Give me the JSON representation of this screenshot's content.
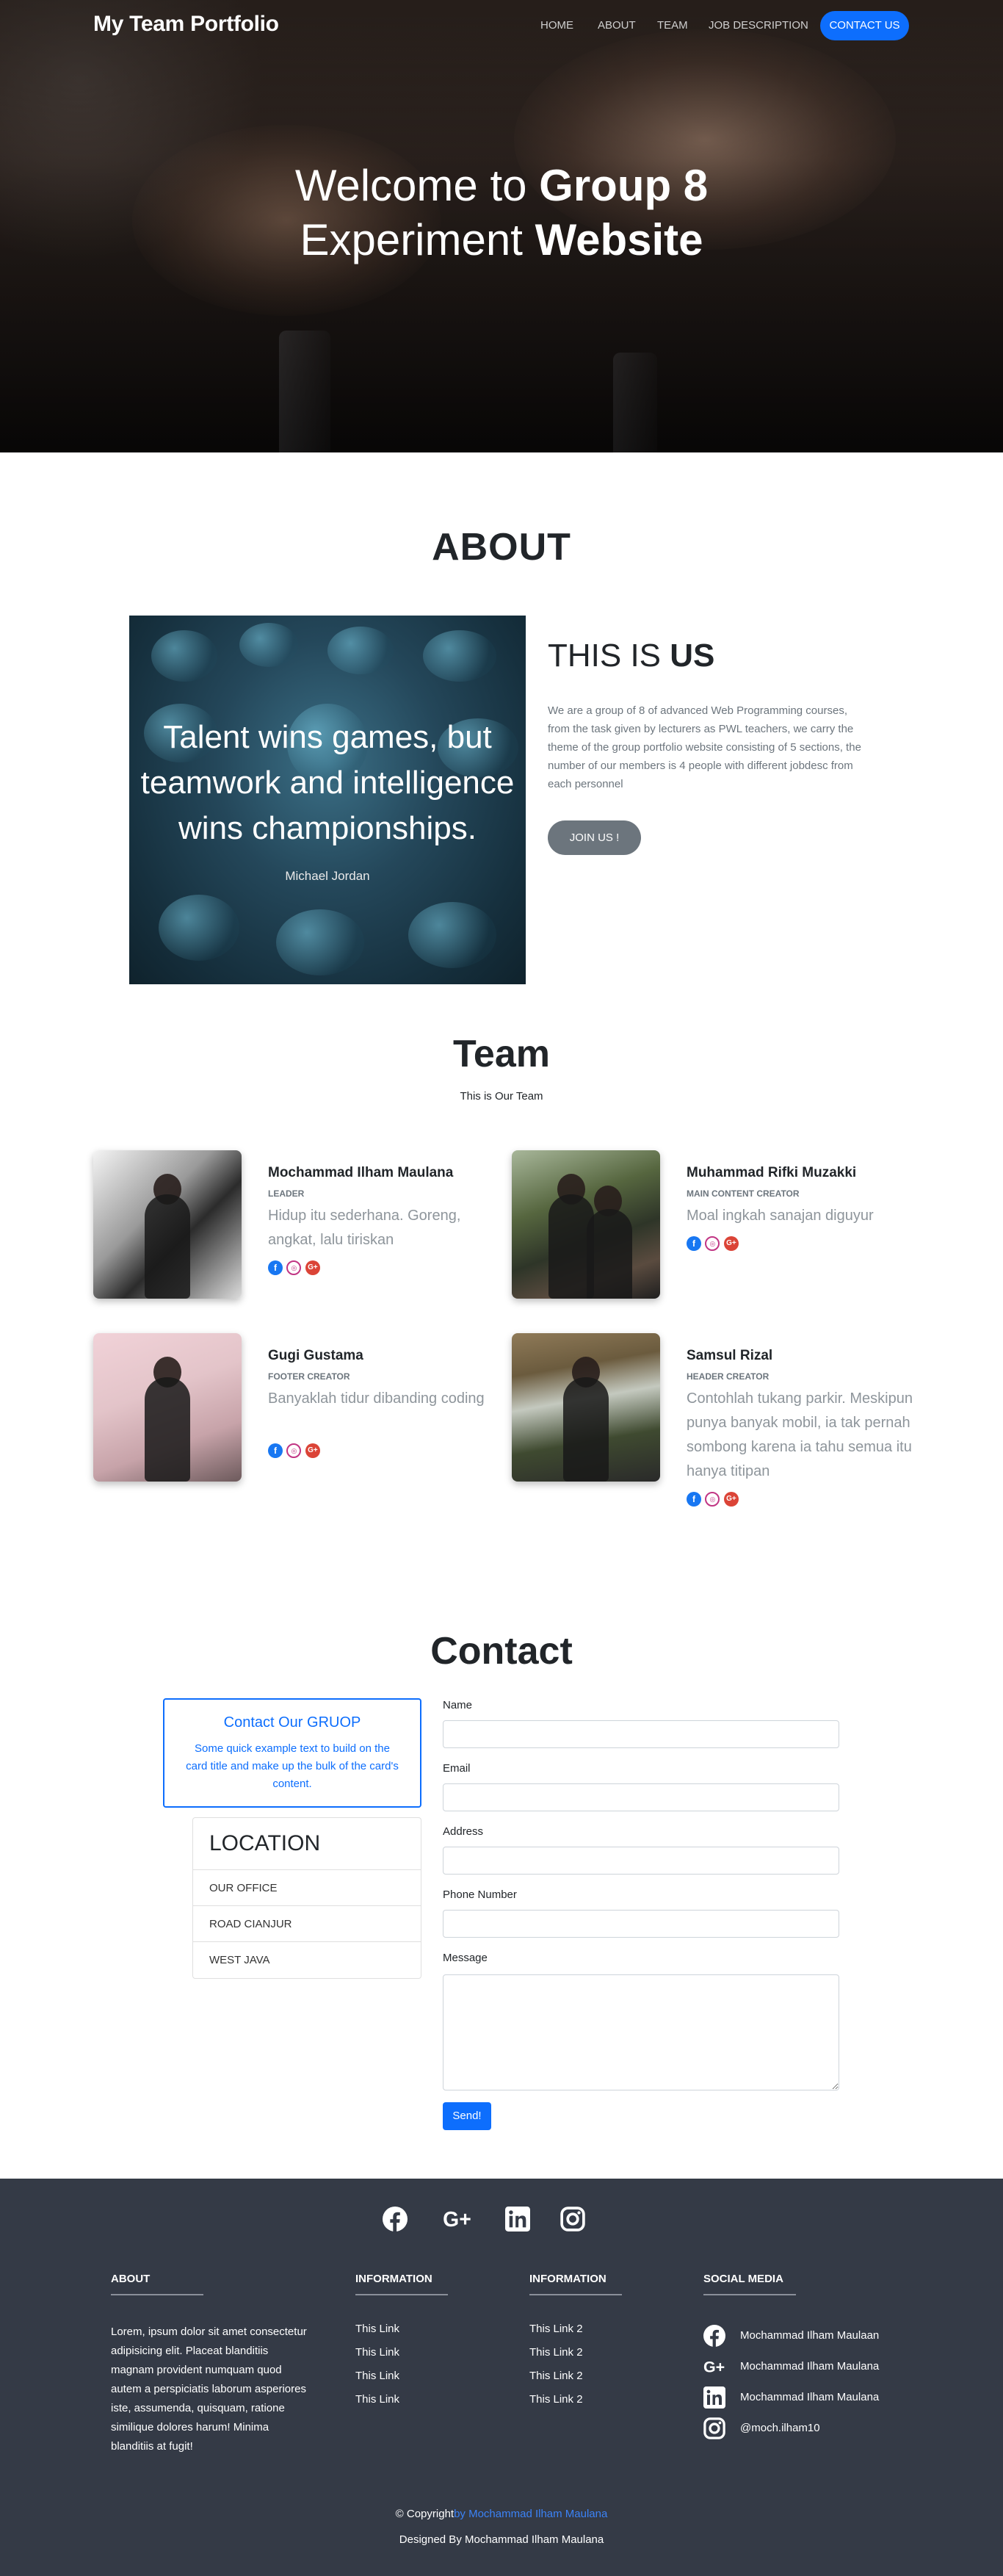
{
  "nav": {
    "brand": "My Team Portfolio",
    "links": [
      "HOME",
      "ABOUT",
      "TEAM",
      "JOB DESCRIPTION"
    ],
    "cta": "CONTACT US"
  },
  "hero": {
    "line1_light": "Welcome to ",
    "line1_bold": "Group 8",
    "line2_light": "Experiment ",
    "line2_bold": "Website"
  },
  "about": {
    "heading": "ABOUT",
    "quote": "Talent wins games, but teamwork and intelligence wins championships.",
    "quote_author": "Michael Jordan",
    "sub_light": "THIS IS ",
    "sub_bold": "US",
    "description": "We are a group of 8 of advanced Web Programming courses, from the task given by lecturers as PWL teachers, we carry the theme of the group portfolio website consisting of 5 sections, the number of our members is 4 people with different jobdesc from each personnel",
    "button": "JOIN US !"
  },
  "team": {
    "heading": "Team",
    "subtitle": "This is Our Team",
    "members": [
      {
        "name": "Mochammad Ilham Maulana",
        "role": "LEADER",
        "desc": "Hidup itu sederhana. Goreng, angkat, lalu tiriskan"
      },
      {
        "name": "Muhammad Rifki Muzakki",
        "role": "MAIN CONTENT CREATOR",
        "desc": "Moal ingkah sanajan diguyur"
      },
      {
        "name": "Gugi Gustama",
        "role": "FOOTER CREATOR",
        "desc": "Banyaklah tidur dibanding coding"
      },
      {
        "name": "Samsul Rizal",
        "role": "HEADER CREATOR",
        "desc": "Contohlah tukang parkir. Meskipun punya banyak mobil, ia tak pernah sombong karena ia tahu semua itu hanya titipan"
      }
    ],
    "social_icons": [
      "facebook-icon",
      "instagram-icon",
      "google-plus-icon"
    ]
  },
  "contact": {
    "heading": "Contact",
    "card_title": "Contact Our GRUOP",
    "card_text": "Some quick example text to build on the card title and make up the bulk of the card's content.",
    "location_title": "LOCATION",
    "locations": [
      "OUR OFFICE",
      "ROAD CIANJUR",
      "WEST JAVA"
    ],
    "fields": {
      "name": "Name",
      "email": "Email",
      "address": "Address",
      "phone": "Phone Number",
      "message": "Message"
    },
    "send": "Send!"
  },
  "footer": {
    "top_icons": [
      "facebook-icon",
      "google-plus-icon",
      "linkedin-icon",
      "instagram-icon"
    ],
    "about_title": "ABOUT",
    "about_text": "Lorem, ipsum dolor sit amet consectetur adipisicing elit. Placeat blanditiis magnam provident numquam quod autem a perspiciatis laborum asperiores iste, assumenda, quisquam, ratione similique dolores harum! Minima blanditiis at fugit!",
    "info1_title": "INFORMATION",
    "info1_links": [
      "This Link",
      "This Link",
      "This Link",
      "This Link"
    ],
    "info2_title": "INFORMATION",
    "info2_links": [
      "This Link 2",
      "This Link 2",
      "This Link 2",
      "This Link 2"
    ],
    "social_title": "SOCIAL MEDIA",
    "social": [
      "Mochammad Ilham Maulaan",
      "Mochammad Ilham Maulana",
      "Mochammad Ilham Maulana",
      "@moch.ilham10"
    ],
    "copyright_prefix": "© Copyright",
    "copyright_author": "by Mochammad Ilham Maulana",
    "designed": "Designed By Mochammad Ilham Maulana"
  },
  "colors": {
    "primary": "#0d6efd",
    "secondary": "#6c757d",
    "footer_bg": "#343a46"
  }
}
